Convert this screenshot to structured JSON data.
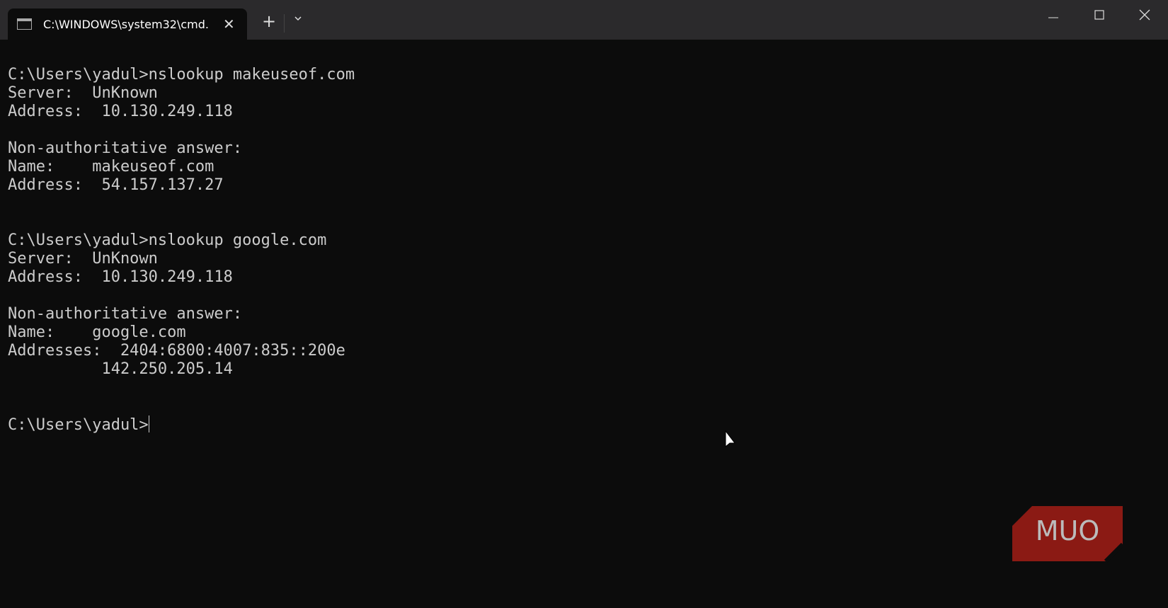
{
  "window": {
    "tab_title": "C:\\WINDOWS\\system32\\cmd.",
    "tab_close": "✕",
    "new_tab": "+",
    "dropdown": "⌄",
    "minimize": "—",
    "maximize": "☐",
    "close": "✕"
  },
  "terminal": {
    "lines": [
      "C:\\Users\\yadul>nslookup makeuseof.com",
      "Server:  UnKnown",
      "Address:  10.130.249.118",
      "",
      "Non-authoritative answer:",
      "Name:    makeuseof.com",
      "Address:  54.157.137.27",
      "",
      "",
      "C:\\Users\\yadul>nslookup google.com",
      "Server:  UnKnown",
      "Address:  10.130.249.118",
      "",
      "Non-authoritative answer:",
      "Name:    google.com",
      "Addresses:  2404:6800:4007:835::200e",
      "          142.250.205.14",
      "",
      ""
    ],
    "prompt": "C:\\Users\\yadul>"
  },
  "watermark": {
    "text": "MUO",
    "color": "#8b1a14"
  }
}
